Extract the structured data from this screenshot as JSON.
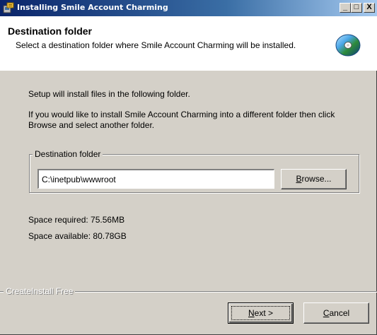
{
  "window": {
    "title": "Installing Smile Account Charming",
    "app_icon": "installer-icon",
    "controls": {
      "minimize": "_",
      "maximize": "□",
      "close": "X"
    }
  },
  "header": {
    "title": "Destination folder",
    "description": "Select a destination folder where Smile Account Charming will be installed.",
    "icon": "cd-disc-icon"
  },
  "body": {
    "intro": "Setup will install files in the following folder.",
    "instruction": "If you would like to install Smile Account Charming into a different folder then click Browse and select another folder."
  },
  "destination": {
    "group_label": "Destination folder",
    "path_value": "C:\\inetpub\\wwwroot",
    "browse_label": "Browse...",
    "browse_accel": "B"
  },
  "space": {
    "required": "Space required: 75.56MB",
    "available": "Space available: 80.78GB"
  },
  "footer": {
    "brand": "CreateInstall Free",
    "next_label": "Next >",
    "cancel_label": "Cancel"
  }
}
